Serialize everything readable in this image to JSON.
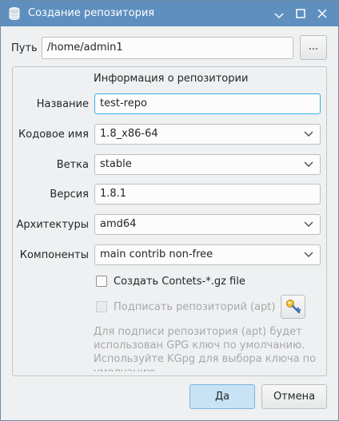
{
  "window": {
    "title": "Создание репозитория"
  },
  "path": {
    "label": "Путь",
    "value": "/home/admin1",
    "browse_label": "..."
  },
  "group": {
    "title": "Информация о репозитории",
    "name": {
      "label": "Название",
      "value": "test-repo"
    },
    "codename": {
      "label": "Кодовое имя",
      "value": "1.8_x86-64"
    },
    "branch": {
      "label": "Ветка",
      "value": "stable"
    },
    "version": {
      "label": "Версия",
      "value": "1.8.1"
    },
    "arch": {
      "label": "Архитектуры",
      "value": "amd64"
    },
    "components": {
      "label": "Компоненты",
      "value": "main contrib non-free"
    },
    "create_contents": {
      "label": "Создать Contets-*.gz file",
      "checked": false
    },
    "sign_repo": {
      "label": "Подписать репозиторий (apt)",
      "checked": false,
      "enabled": false
    },
    "hint": "Для подписи репозитория (apt) будет использован GPG ключ по умолчанию. Используйте KGpg для выбора ключа по умолчанию."
  },
  "buttons": {
    "ok": "Да",
    "cancel": "Отмена"
  },
  "colors": {
    "titlebar": "#5e8fbf",
    "focus": "#3daee9",
    "ok_button": "#c9e3f6"
  },
  "icons": [
    "database-icon",
    "minimize-icon",
    "maximize-icon",
    "close-icon",
    "key-icon",
    "chevron-down-icon"
  ]
}
